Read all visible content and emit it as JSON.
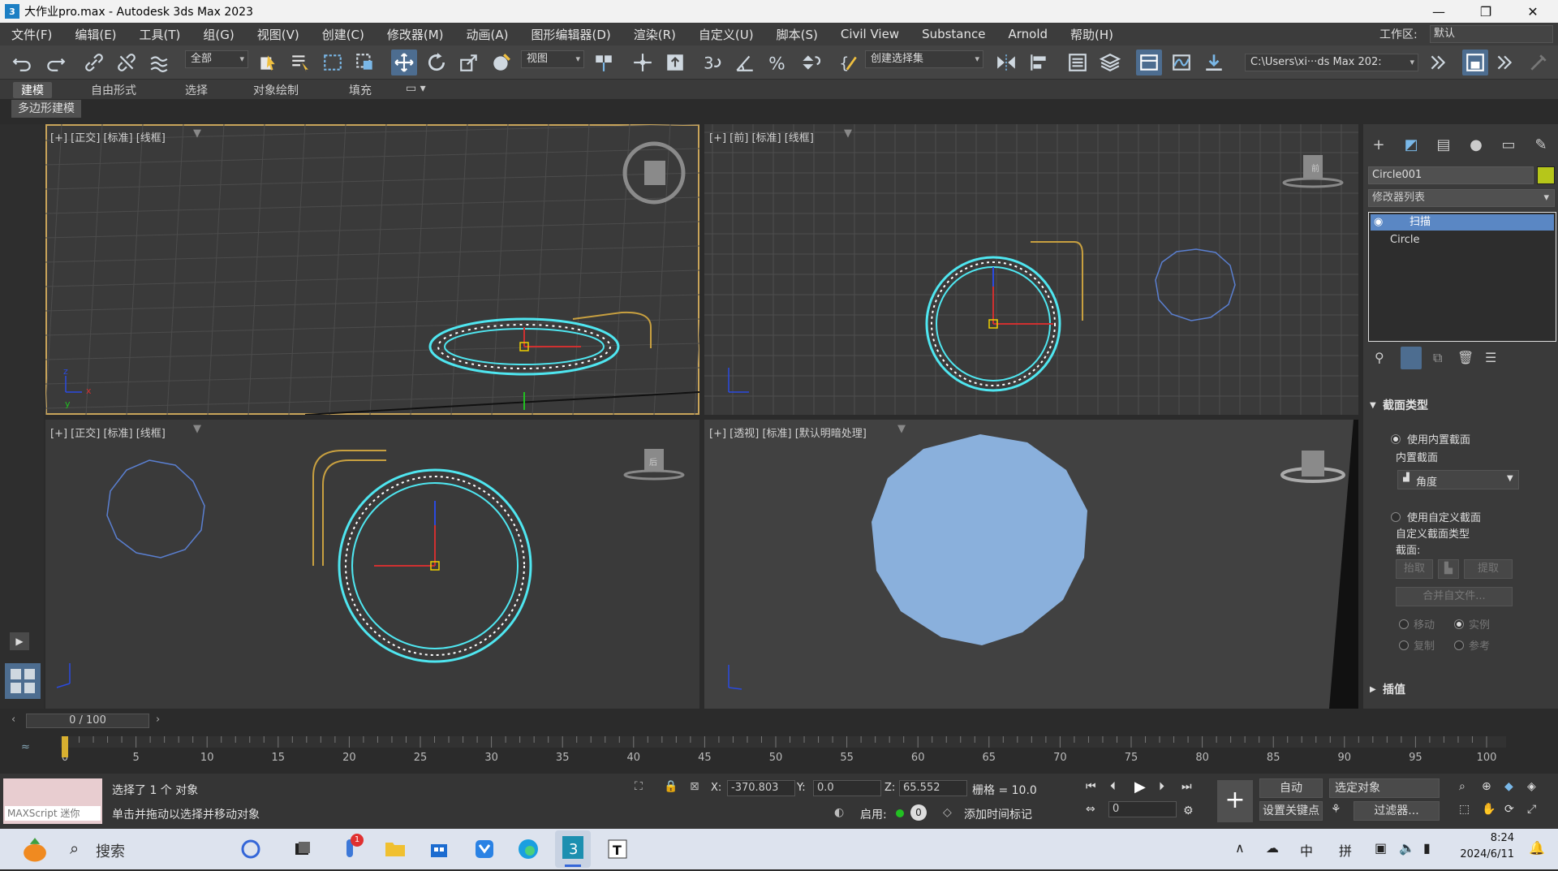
{
  "window": {
    "title": "大作业pro.max - Autodesk 3ds Max 2023",
    "app_icon_text": "3"
  },
  "menu": {
    "items": [
      "文件(F)",
      "编辑(E)",
      "工具(T)",
      "组(G)",
      "视图(V)",
      "创建(C)",
      "修改器(M)",
      "动画(A)",
      "图形编辑器(D)",
      "渲染(R)",
      "自定义(U)",
      "脚本(S)",
      "Civil View",
      "Substance",
      "Arnold",
      "帮助(H)"
    ],
    "workspace_label": "工作区:",
    "workspace_value": "默认"
  },
  "toolbar": {
    "selection_filter": "全部",
    "ref_coord": "视图",
    "named_selection": "创建选择集",
    "project_path": "C:\\Users\\xi···ds Max 202:"
  },
  "ribbon": {
    "tabs": [
      "建模",
      "自由形式",
      "选择",
      "对象绘制",
      "填充"
    ],
    "active_sub": "多边形建模"
  },
  "viewports": {
    "top_left": {
      "label": "[+] [正交] [标准] [线框]"
    },
    "top_right": {
      "label": "[+] [前] [标准] [线框]"
    },
    "bottom_left": {
      "label": "[+] [正交] [标准] [线框]"
    },
    "bottom_right": {
      "label": "[+] [透视] [标准] [默认明暗处理]"
    },
    "axis_labels": {
      "x": "x",
      "y": "y",
      "z": "z"
    },
    "viewcube_front": "前",
    "viewcube_back": "后"
  },
  "command_panel": {
    "object_name": "Circle001",
    "object_color": "#b6c61a",
    "modifier_list": "修改器列表",
    "stack": [
      "扫描",
      "Circle"
    ],
    "rollout_section_type": "截面类型",
    "use_builtin": "使用内置截面",
    "builtin_group": "内置截面",
    "builtin_value": "角度",
    "use_custom": "使用自定义截面",
    "custom_group": "自定义截面类型",
    "section_label": "截面:",
    "pick_btn": "抬取",
    "extract_btn": "提取",
    "merge_btn": "合并自文件...",
    "move": "移动",
    "instance": "实例",
    "copy": "复制",
    "reference": "参考",
    "rollout_interp": "插值"
  },
  "timeline": {
    "slider": "0 / 100",
    "ticks": [
      0,
      5,
      10,
      15,
      20,
      25,
      30,
      35,
      40,
      45,
      50,
      55,
      60,
      65,
      70,
      75,
      80,
      85,
      90,
      95,
      100
    ]
  },
  "status": {
    "maxscript": "MAXScript 迷你",
    "selected": "选择了 1 个 对象",
    "hint": "单击并拖动以选择并移动对象",
    "x_label": "X:",
    "x_value": "-370.803",
    "y_label": "Y:",
    "y_value": "0.0",
    "z_label": "Z:",
    "z_value": "65.552",
    "grid": "栅格 = 10.0",
    "enable": "启用:",
    "enable_value": "0",
    "add_time_tag": "添加时间标记",
    "auto": "自动",
    "selected_object": "选定对象",
    "set_key": "设置关键点",
    "filters": "过滤器...",
    "frame": "0"
  },
  "taskbar": {
    "search": "搜索",
    "lang": "中",
    "ime": "拼",
    "time": "8:24",
    "date": "2024/6/11",
    "badge": "1"
  },
  "colors": {
    "selection_cyan": "#4fe6f0",
    "shape_yellow": "#c8a040",
    "shape_blue": "#5a7fd0",
    "shaded_blue": "#8ab0dc"
  }
}
